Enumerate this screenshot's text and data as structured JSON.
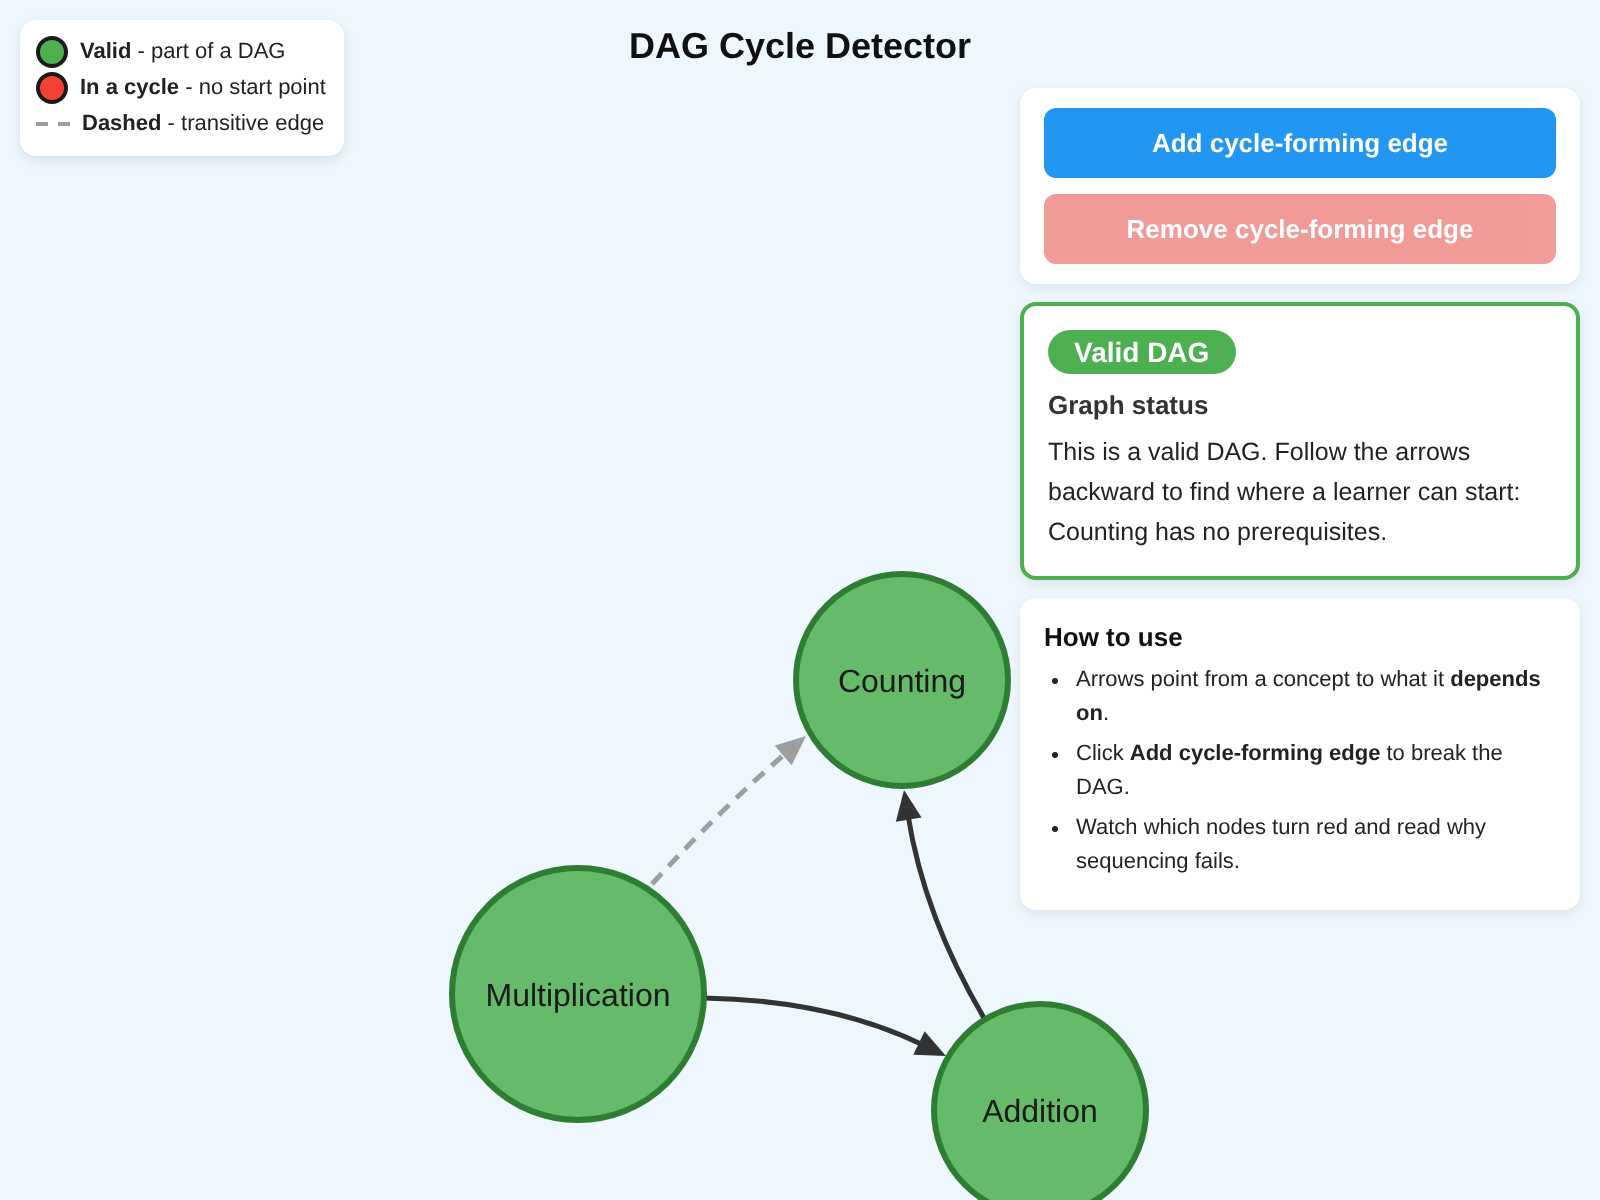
{
  "title": "DAG Cycle Detector",
  "legend": {
    "items": [
      {
        "kind": "dot",
        "color": "#4caf50",
        "text": "**Valid** - part of a DAG"
      },
      {
        "kind": "dot",
        "color": "#f44336",
        "text": "**In a cycle** - no start point"
      },
      {
        "kind": "dashed",
        "text": "**Dashed** - transitive edge"
      }
    ]
  },
  "controls": {
    "buttons": [
      {
        "kind": "add",
        "label": "Add cycle-forming edge",
        "disabled": false
      },
      {
        "kind": "remove",
        "label": "Remove cycle-forming edge",
        "disabled": true
      }
    ]
  },
  "status": {
    "valid": true,
    "badge": "Valid DAG",
    "heading": "Graph status",
    "message": "This is a valid DAG. Follow the arrows backward to find where a learner can start: Counting has no prerequisites."
  },
  "help": {
    "title": "How to use",
    "items": [
      "Arrows point from a concept to what it **depends on**.",
      "Click **Add cycle-forming edge** to break the DAG.",
      "Watch which nodes turn red and read why sequencing fails."
    ]
  },
  "graph": {
    "nodes": [
      {
        "label": "Counting",
        "in_cycle": false
      },
      {
        "label": "Multiplication",
        "in_cycle": false
      },
      {
        "label": "Addition",
        "in_cycle": false
      }
    ],
    "edges": [
      {
        "transitive": false
      },
      {
        "transitive": false
      },
      {
        "transitive": true
      }
    ]
  }
}
